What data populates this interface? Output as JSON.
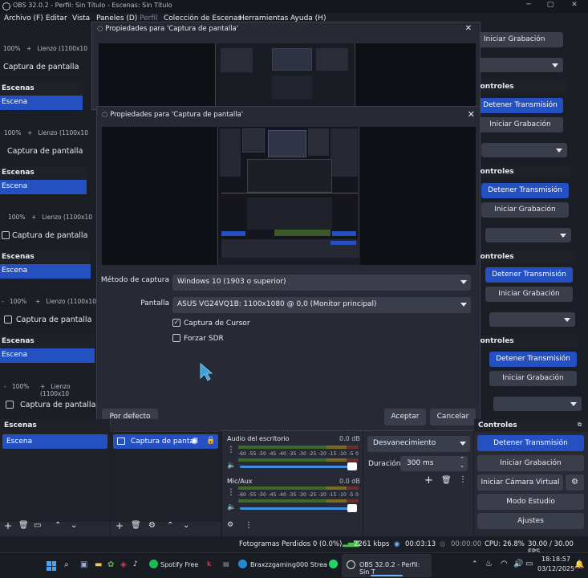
{
  "window": {
    "title": "OBS 32.0.2 - Perfil: Sin Título - Escenas: Sin Título"
  },
  "menu": [
    "Archivo (F)",
    "Editar",
    "Vista",
    "Paneles (D)",
    "Perfil",
    "Colección de Escenas",
    "Herramientas",
    "Ayuda (H)"
  ],
  "cascade": {
    "lienzo": "Lienzo (1100x10",
    "zoom": "100%",
    "captura": "Captura de pantalla",
    "escenas": "Escenas",
    "escena": "Escena",
    "controles": "Controles",
    "detener": "Detener Transmisión",
    "iniciar": "Iniciar Grabación"
  },
  "dialog_back": {
    "title": "Propiedades para 'Captura de pantalla'"
  },
  "dialog": {
    "title": "Propiedades para 'Captura de pantalla'",
    "metodo_label": "Método de captura",
    "metodo_value": "Windows 10 (1903 o superior)",
    "pantalla_label": "Pantalla",
    "pantalla_value": "ASUS VG24VQ1B: 1100x1080 @ 0,0 (Monitor principal)",
    "cursor_label": "Captura de Cursor",
    "cursor_checked": true,
    "sdr_label": "Forzar SDR",
    "sdr_checked": false,
    "defaults": "Por defecto",
    "accept": "Aceptar",
    "cancel": "Cancelar"
  },
  "scenes": {
    "header": "Escenas",
    "items": [
      "Escena"
    ]
  },
  "sources": {
    "items": [
      "Captura de pantall"
    ]
  },
  "audio": {
    "channels": [
      {
        "name": "Audio del escritorio",
        "db": "0.0 dB"
      },
      {
        "name": "Mic/Aux",
        "db": "0.0 dB"
      }
    ],
    "ticks": [
      "-60",
      "-55",
      "-50",
      "-45",
      "-40",
      "-35",
      "-30",
      "-25",
      "-20",
      "-15",
      "-10",
      "-5",
      "0"
    ]
  },
  "transitions": {
    "type": "Desvanecimiento",
    "duration_label": "Duración",
    "duration_value": "300 ms"
  },
  "controls": {
    "header": "Controles",
    "stream": "Detener Transmisión",
    "record": "Iniciar Grabación",
    "vcam": "Iniciar Cámara Virtual",
    "studio": "Modo Estudio",
    "settings": "Ajustes"
  },
  "status": {
    "dropped": "Fotogramas Perdidos 0 (0.0%)",
    "kbps": "2261 kbps",
    "stream_time": "00:03:13",
    "rec_time": "00:00:00",
    "cpu": "CPU: 26.8%",
    "fps": "30.00 / 30.00 FPS"
  },
  "taskbar": {
    "spotify": "Spotify Free",
    "edge": "Braxzzgaming000 Strea",
    "obs": "OBS 32.0.2 - Perfil: Sin T",
    "time": "18:18:57",
    "date": "03/12/2025"
  },
  "colors": {
    "accent": "#2450c2",
    "panel": "#272a35",
    "dark": "#1c1e26"
  }
}
